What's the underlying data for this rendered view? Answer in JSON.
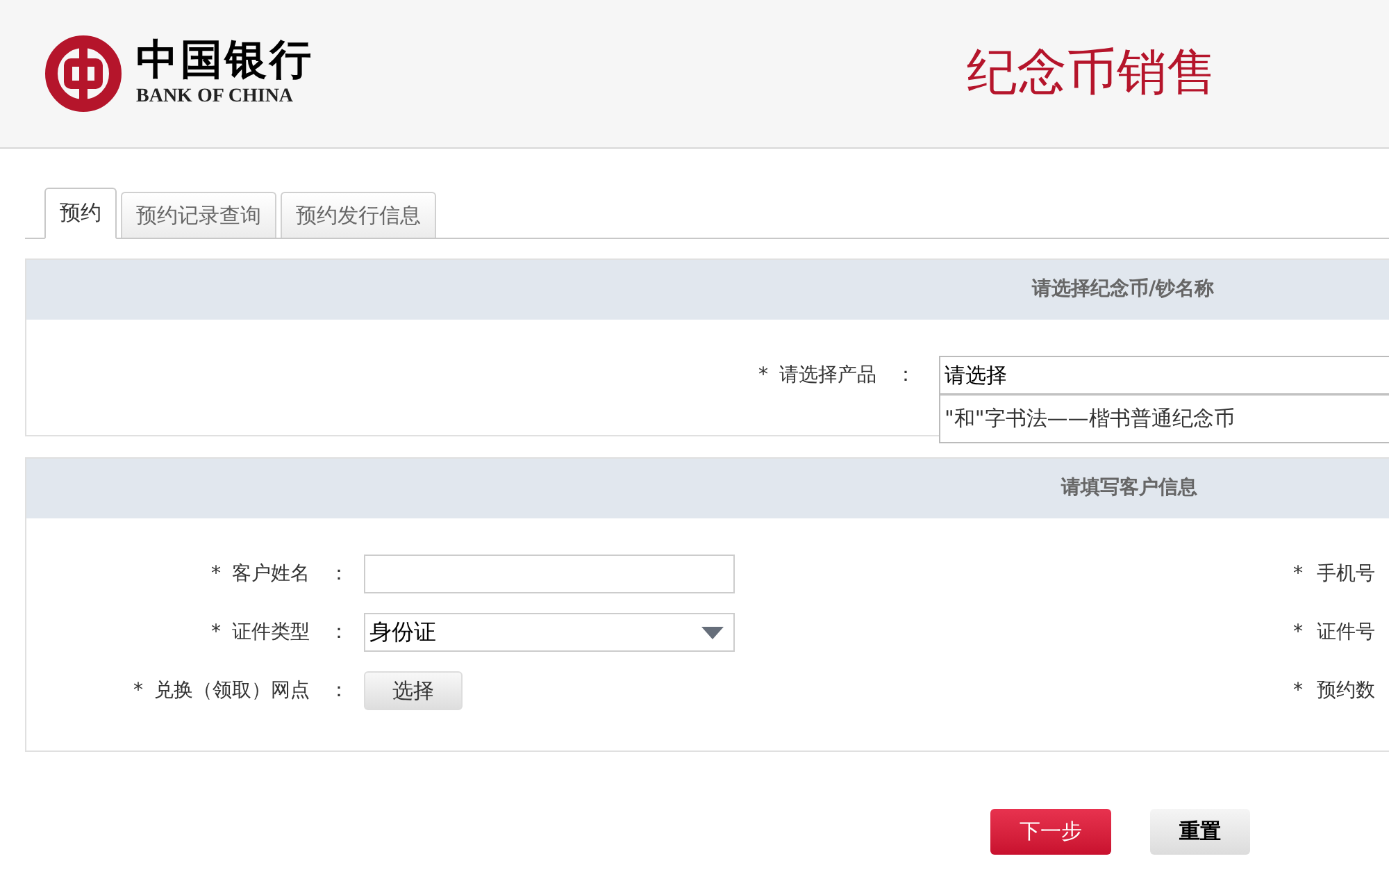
{
  "header": {
    "logo_cn": "中国银行",
    "logo_en": "BANK OF CHINA",
    "title": "纪念币销售"
  },
  "tabs": [
    {
      "label": "预约",
      "selected": true
    },
    {
      "label": "预约记录查询",
      "selected": false
    },
    {
      "label": "预约发行信息",
      "selected": false
    }
  ],
  "product_section": {
    "heading": "请选择纪念币/钞名称",
    "field": {
      "mark": "*",
      "label": "请选择产品",
      "separator": "：",
      "value": "请选择",
      "expanded": true,
      "options": [
        "\"和\"字书法——楷书普通纪念币"
      ]
    }
  },
  "customer_section": {
    "heading": "请填写客户信息",
    "left_fields": [
      {
        "kind": "text",
        "mark": "*",
        "label": "客户姓名",
        "separator": "："
      },
      {
        "kind": "select",
        "mark": "*",
        "label": "证件类型",
        "separator": "：",
        "value": "身份证"
      },
      {
        "kind": "button",
        "mark": "*",
        "label": "兑换（领取）网点",
        "separator": "：",
        "button": "选择"
      }
    ],
    "right_fields": [
      {
        "mark": "*",
        "label": "手机号"
      },
      {
        "mark": "*",
        "label": "证件号"
      },
      {
        "mark": "*",
        "label": "预约数"
      }
    ]
  },
  "buttons": [
    {
      "kind": "primary",
      "label": "下一步"
    },
    {
      "kind": "secondary",
      "label": "重置"
    }
  ]
}
